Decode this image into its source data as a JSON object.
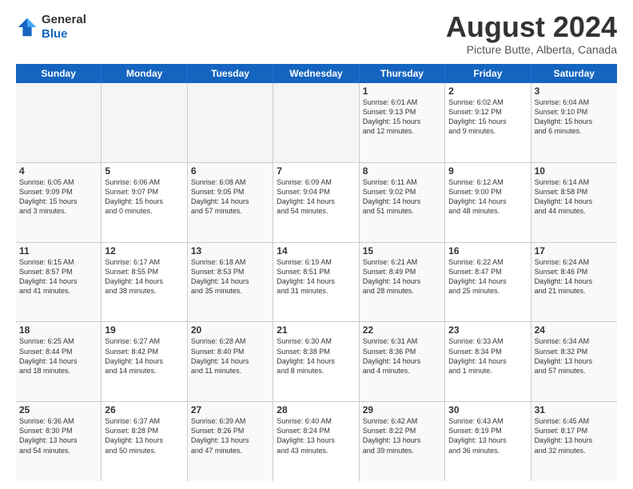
{
  "header": {
    "logo_line1": "General",
    "logo_line2": "Blue",
    "month_title": "August 2024",
    "location": "Picture Butte, Alberta, Canada"
  },
  "weekdays": [
    "Sunday",
    "Monday",
    "Tuesday",
    "Wednesday",
    "Thursday",
    "Friday",
    "Saturday"
  ],
  "rows": [
    [
      {
        "day": "",
        "info": "",
        "empty": true
      },
      {
        "day": "",
        "info": "",
        "empty": true
      },
      {
        "day": "",
        "info": "",
        "empty": true
      },
      {
        "day": "",
        "info": "",
        "empty": true
      },
      {
        "day": "1",
        "info": "Sunrise: 6:01 AM\nSunset: 9:13 PM\nDaylight: 15 hours\nand 12 minutes.",
        "empty": false
      },
      {
        "day": "2",
        "info": "Sunrise: 6:02 AM\nSunset: 9:12 PM\nDaylight: 15 hours\nand 9 minutes.",
        "empty": false
      },
      {
        "day": "3",
        "info": "Sunrise: 6:04 AM\nSunset: 9:10 PM\nDaylight: 15 hours\nand 6 minutes.",
        "empty": false
      }
    ],
    [
      {
        "day": "4",
        "info": "Sunrise: 6:05 AM\nSunset: 9:09 PM\nDaylight: 15 hours\nand 3 minutes.",
        "empty": false
      },
      {
        "day": "5",
        "info": "Sunrise: 6:06 AM\nSunset: 9:07 PM\nDaylight: 15 hours\nand 0 minutes.",
        "empty": false
      },
      {
        "day": "6",
        "info": "Sunrise: 6:08 AM\nSunset: 9:05 PM\nDaylight: 14 hours\nand 57 minutes.",
        "empty": false
      },
      {
        "day": "7",
        "info": "Sunrise: 6:09 AM\nSunset: 9:04 PM\nDaylight: 14 hours\nand 54 minutes.",
        "empty": false
      },
      {
        "day": "8",
        "info": "Sunrise: 6:11 AM\nSunset: 9:02 PM\nDaylight: 14 hours\nand 51 minutes.",
        "empty": false
      },
      {
        "day": "9",
        "info": "Sunrise: 6:12 AM\nSunset: 9:00 PM\nDaylight: 14 hours\nand 48 minutes.",
        "empty": false
      },
      {
        "day": "10",
        "info": "Sunrise: 6:14 AM\nSunset: 8:58 PM\nDaylight: 14 hours\nand 44 minutes.",
        "empty": false
      }
    ],
    [
      {
        "day": "11",
        "info": "Sunrise: 6:15 AM\nSunset: 8:57 PM\nDaylight: 14 hours\nand 41 minutes.",
        "empty": false
      },
      {
        "day": "12",
        "info": "Sunrise: 6:17 AM\nSunset: 8:55 PM\nDaylight: 14 hours\nand 38 minutes.",
        "empty": false
      },
      {
        "day": "13",
        "info": "Sunrise: 6:18 AM\nSunset: 8:53 PM\nDaylight: 14 hours\nand 35 minutes.",
        "empty": false
      },
      {
        "day": "14",
        "info": "Sunrise: 6:19 AM\nSunset: 8:51 PM\nDaylight: 14 hours\nand 31 minutes.",
        "empty": false
      },
      {
        "day": "15",
        "info": "Sunrise: 6:21 AM\nSunset: 8:49 PM\nDaylight: 14 hours\nand 28 minutes.",
        "empty": false
      },
      {
        "day": "16",
        "info": "Sunrise: 6:22 AM\nSunset: 8:47 PM\nDaylight: 14 hours\nand 25 minutes.",
        "empty": false
      },
      {
        "day": "17",
        "info": "Sunrise: 6:24 AM\nSunset: 8:46 PM\nDaylight: 14 hours\nand 21 minutes.",
        "empty": false
      }
    ],
    [
      {
        "day": "18",
        "info": "Sunrise: 6:25 AM\nSunset: 8:44 PM\nDaylight: 14 hours\nand 18 minutes.",
        "empty": false
      },
      {
        "day": "19",
        "info": "Sunrise: 6:27 AM\nSunset: 8:42 PM\nDaylight: 14 hours\nand 14 minutes.",
        "empty": false
      },
      {
        "day": "20",
        "info": "Sunrise: 6:28 AM\nSunset: 8:40 PM\nDaylight: 14 hours\nand 11 minutes.",
        "empty": false
      },
      {
        "day": "21",
        "info": "Sunrise: 6:30 AM\nSunset: 8:38 PM\nDaylight: 14 hours\nand 8 minutes.",
        "empty": false
      },
      {
        "day": "22",
        "info": "Sunrise: 6:31 AM\nSunset: 8:36 PM\nDaylight: 14 hours\nand 4 minutes.",
        "empty": false
      },
      {
        "day": "23",
        "info": "Sunrise: 6:33 AM\nSunset: 8:34 PM\nDaylight: 14 hours\nand 1 minute.",
        "empty": false
      },
      {
        "day": "24",
        "info": "Sunrise: 6:34 AM\nSunset: 8:32 PM\nDaylight: 13 hours\nand 57 minutes.",
        "empty": false
      }
    ],
    [
      {
        "day": "25",
        "info": "Sunrise: 6:36 AM\nSunset: 8:30 PM\nDaylight: 13 hours\nand 54 minutes.",
        "empty": false
      },
      {
        "day": "26",
        "info": "Sunrise: 6:37 AM\nSunset: 8:28 PM\nDaylight: 13 hours\nand 50 minutes.",
        "empty": false
      },
      {
        "day": "27",
        "info": "Sunrise: 6:39 AM\nSunset: 8:26 PM\nDaylight: 13 hours\nand 47 minutes.",
        "empty": false
      },
      {
        "day": "28",
        "info": "Sunrise: 6:40 AM\nSunset: 8:24 PM\nDaylight: 13 hours\nand 43 minutes.",
        "empty": false
      },
      {
        "day": "29",
        "info": "Sunrise: 6:42 AM\nSunset: 8:22 PM\nDaylight: 13 hours\nand 39 minutes.",
        "empty": false
      },
      {
        "day": "30",
        "info": "Sunrise: 6:43 AM\nSunset: 8:19 PM\nDaylight: 13 hours\nand 36 minutes.",
        "empty": false
      },
      {
        "day": "31",
        "info": "Sunrise: 6:45 AM\nSunset: 8:17 PM\nDaylight: 13 hours\nand 32 minutes.",
        "empty": false
      }
    ]
  ]
}
